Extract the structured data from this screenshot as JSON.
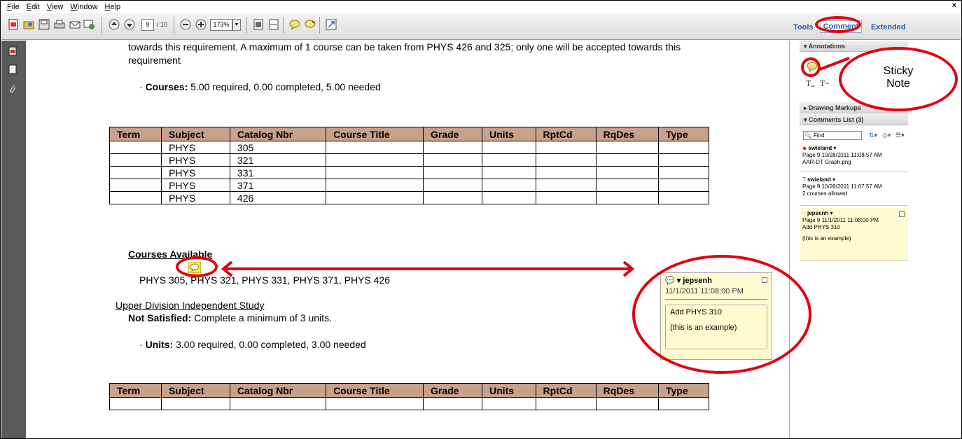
{
  "menu": [
    "File",
    "Edit",
    "View",
    "Window",
    "Help"
  ],
  "window_close": "×",
  "toolbar": {
    "page_current": "9",
    "page_total": "/ 10",
    "zoom": "173%",
    "tools_label": "Tools",
    "comment_label": "Comment",
    "extended_label": "Extended"
  },
  "document": {
    "req_line1": "towards this requirement. A maximum of 1 course can be taken from PHYS 426 and 325; only one will be accepted towards this",
    "req_line2": "requirement",
    "courses_label": "Courses:",
    "courses_text": " 5.00 required, 0.00 completed, 5.00 needed",
    "table_headers": [
      "Term",
      "Subject",
      "Catalog Nbr",
      "Course Title",
      "Grade",
      "Units",
      "RptCd",
      "RqDes",
      "Type"
    ],
    "table_rows": [
      [
        "",
        "PHYS",
        "305",
        "",
        "",
        "",
        "",
        "",
        ""
      ],
      [
        "",
        "PHYS",
        "321",
        "",
        "",
        "",
        "",
        "",
        ""
      ],
      [
        "",
        "PHYS",
        "331",
        "",
        "",
        "",
        "",
        "",
        ""
      ],
      [
        "",
        "PHYS",
        "371",
        "",
        "",
        "",
        "",
        "",
        ""
      ],
      [
        "",
        "PHYS",
        "426",
        "",
        "",
        "",
        "",
        "",
        ""
      ]
    ],
    "courses_available": "Courses Available",
    "courses_list": "PHYS  305, PHYS  321, PHYS  331, PHYS  371, PHYS  426",
    "upper_div": "Upper Division Independent Study",
    "not_satisfied_label": "Not Satisfied:",
    "not_satisfied_text": " Complete a minimum of 3 units.",
    "units_label": "Units:",
    "units_text": " 3.00 required, 0.00 completed, 3.00 needed",
    "table2_headers": [
      "Term",
      "Subject",
      "Catalog Nbr",
      "Course Title",
      "Grade",
      "Units",
      "RptCd",
      "RqDes",
      "Type"
    ]
  },
  "note_popup": {
    "author": "jepsenh",
    "date": "11/1/2011 11:08:00 PM",
    "line1": "Add PHYS 310",
    "line2": "(this is an example)"
  },
  "panel": {
    "annotations": "Annotations",
    "drawing_markups": "Drawing Markups",
    "comments_list": "Comments List (3)",
    "find_placeholder": "Find",
    "comments": [
      {
        "author": "swieland",
        "meta": "Page 9  10/28/2011 11:08:57 AM",
        "text": "AAR-DT Graph.png"
      },
      {
        "author": "swieland",
        "meta": "Page 9  10/28/2011 11:07:57 AM",
        "text": "2 courses allowed"
      },
      {
        "author": "jepsenh",
        "meta": "Page 9  11/1/2011 11:08:00 PM",
        "text": "Add PHYS 310",
        "text2": "(this is an example)"
      }
    ]
  },
  "callout": {
    "line1": "Sticky",
    "line2": "Note"
  },
  "colors": {
    "accent": "#e3000f",
    "table_header": "#c9a089",
    "note_bg": "#fffbd0",
    "link": "#2a5db0"
  }
}
